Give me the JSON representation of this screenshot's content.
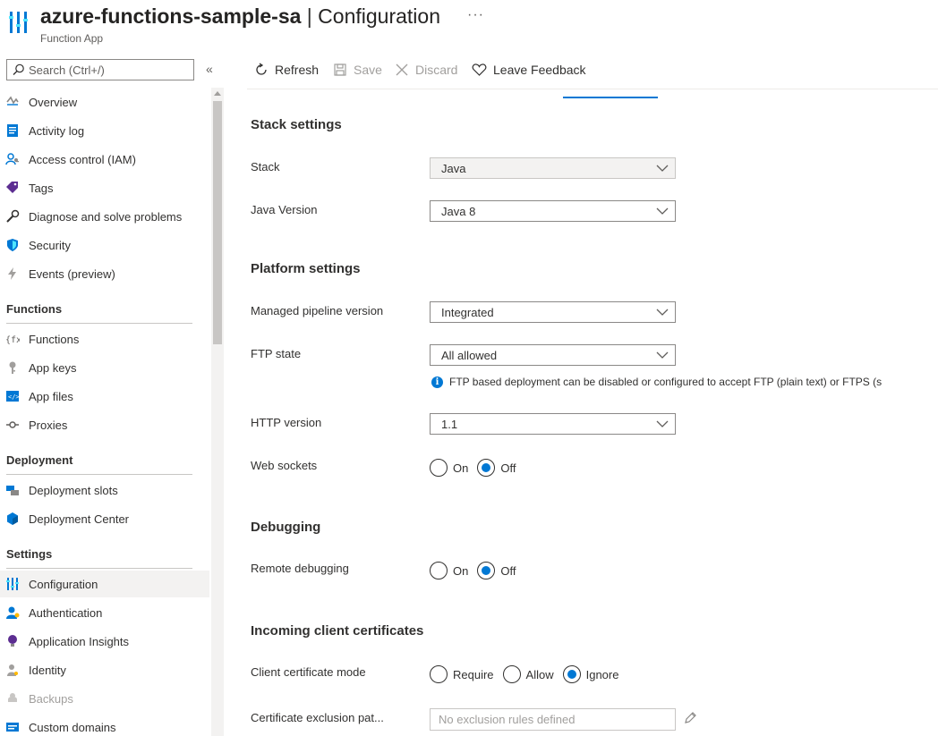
{
  "header": {
    "resource_name": "azure-functions-sample-sa",
    "separator": " | ",
    "page_name": "Configuration",
    "subtitle": "Function App",
    "more_label": "···"
  },
  "sidebar": {
    "search_placeholder": "Search (Ctrl+/)",
    "collapse_label": "«",
    "items": [
      {
        "label": "Overview",
        "icon": "overview-icon"
      },
      {
        "label": "Activity log",
        "icon": "activity-log-icon"
      },
      {
        "label": "Access control (IAM)",
        "icon": "iam-icon"
      },
      {
        "label": "Tags",
        "icon": "tag-icon"
      },
      {
        "label": "Diagnose and solve problems",
        "icon": "wrench-icon"
      },
      {
        "label": "Security",
        "icon": "shield-icon"
      },
      {
        "label": "Events (preview)",
        "icon": "lightning-icon"
      }
    ],
    "sections": {
      "functions": {
        "title": "Functions",
        "items": [
          {
            "label": "Functions",
            "icon": "function-icon"
          },
          {
            "label": "App keys",
            "icon": "key-icon"
          },
          {
            "label": "App files",
            "icon": "code-file-icon"
          },
          {
            "label": "Proxies",
            "icon": "proxy-icon"
          }
        ]
      },
      "deployment": {
        "title": "Deployment",
        "items": [
          {
            "label": "Deployment slots",
            "icon": "slots-icon"
          },
          {
            "label": "Deployment Center",
            "icon": "cube-icon"
          }
        ]
      },
      "settings": {
        "title": "Settings",
        "items": [
          {
            "label": "Configuration",
            "icon": "configuration-icon",
            "active": true
          },
          {
            "label": "Authentication",
            "icon": "person-icon"
          },
          {
            "label": "Application Insights",
            "icon": "lightbulb-icon"
          },
          {
            "label": "Identity",
            "icon": "identity-icon"
          },
          {
            "label": "Backups",
            "icon": "backup-icon",
            "disabled": true
          },
          {
            "label": "Custom domains",
            "icon": "domain-icon"
          }
        ]
      }
    }
  },
  "toolbar": {
    "refresh": "Refresh",
    "save": "Save",
    "discard": "Discard",
    "feedback": "Leave Feedback"
  },
  "stack_settings": {
    "title": "Stack settings",
    "stack_label": "Stack",
    "stack_value": "Java",
    "java_version_label": "Java Version",
    "java_version_value": "Java 8"
  },
  "platform_settings": {
    "title": "Platform settings",
    "pipeline_label": "Managed pipeline version",
    "pipeline_value": "Integrated",
    "ftp_label": "FTP state",
    "ftp_value": "All allowed",
    "ftp_info": "FTP based deployment can be disabled or configured to accept FTP (plain text) or FTPS (s",
    "http_label": "HTTP version",
    "http_value": "1.1",
    "websockets_label": "Web sockets",
    "websockets_on": "On",
    "websockets_off": "Off",
    "websockets_selected": "Off"
  },
  "debugging": {
    "title": "Debugging",
    "remote_label": "Remote debugging",
    "remote_on": "On",
    "remote_off": "Off",
    "remote_selected": "Off"
  },
  "client_certs": {
    "title": "Incoming client certificates",
    "mode_label": "Client certificate mode",
    "mode_require": "Require",
    "mode_allow": "Allow",
    "mode_ignore": "Ignore",
    "mode_selected": "Ignore",
    "exclusion_label": "Certificate exclusion pat...",
    "exclusion_placeholder": "No exclusion rules defined"
  },
  "colors": {
    "accent": "#0078d4",
    "text": "#323130",
    "disabled": "#a19f9d"
  }
}
